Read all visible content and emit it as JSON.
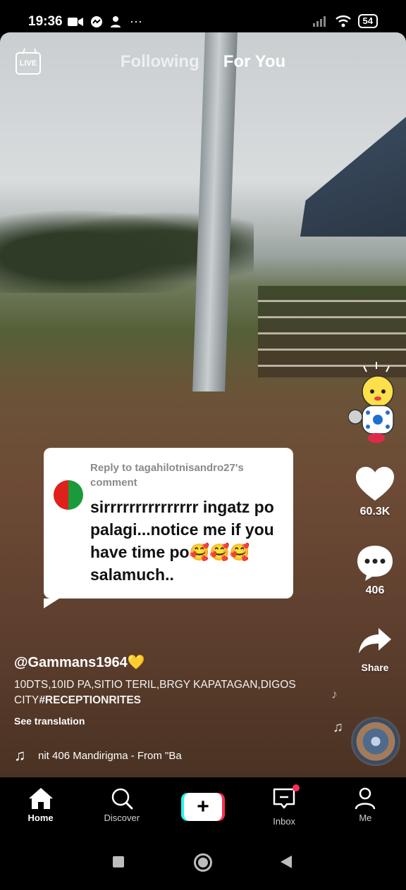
{
  "status_bar": {
    "time": "19:36",
    "more": "···",
    "battery": "54"
  },
  "top_nav": {
    "live_label": "LIVE",
    "tabs": [
      {
        "label": "Following",
        "active": false
      },
      {
        "label": "For You",
        "active": true
      }
    ]
  },
  "comment_card": {
    "reply_to": "Reply to tagahilotnisandro27's comment",
    "text": "sirrrrrrrrrrrrrrr ingatz po palagi...notice me if you have time po🥰🥰🥰salamuch.."
  },
  "right_rail": {
    "likes": "60.3K",
    "comments": "406",
    "share_label": "Share"
  },
  "caption": {
    "username": "@Gammans1964💛",
    "description": "10DTS,10ID PA,SITIO TERIL,BRGY KAPATAGAN,DIGOS CITY",
    "hashtag": "#RECEPTIONRITES",
    "see_translation": "See translation",
    "music": "nit 406    Mandirigma - From \"Ba"
  },
  "bottom_nav": {
    "items": [
      {
        "label": "Home",
        "icon": "home-icon",
        "active": true
      },
      {
        "label": "Discover",
        "icon": "search-icon",
        "active": false
      },
      {
        "label": "+",
        "icon": "create-icon",
        "active": false
      },
      {
        "label": "Inbox",
        "icon": "inbox-icon",
        "active": false
      },
      {
        "label": "Me",
        "icon": "profile-icon",
        "active": false
      }
    ]
  },
  "colors": {
    "accent_cyan": "#25f4ee",
    "accent_red": "#fe2c55"
  }
}
